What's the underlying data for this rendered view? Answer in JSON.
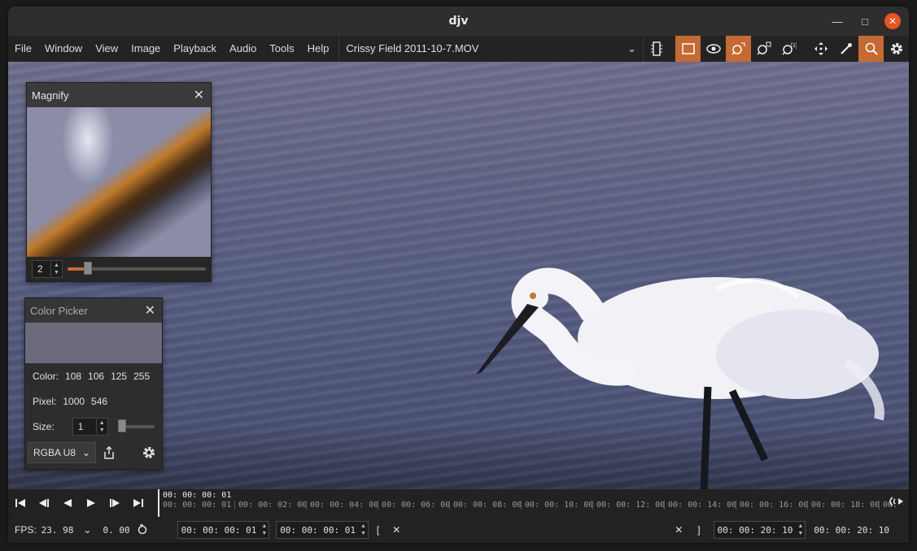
{
  "app": {
    "title": "djv"
  },
  "menu": [
    "File",
    "Window",
    "View",
    "Image",
    "Playback",
    "Audio",
    "Tools",
    "Help"
  ],
  "file": {
    "name": "Crissy Field 2011-10-7.MOV"
  },
  "magnify": {
    "title": "Magnify",
    "zoom": "2",
    "zoom_level": 0.15
  },
  "color_picker": {
    "title": "Color Picker",
    "swatch": "#6c6a7d",
    "color_label": "Color:",
    "color_values": [
      "108",
      "106",
      "125",
      "255"
    ],
    "pixel_label": "Pixel:",
    "pixel_values": [
      "1000",
      "546"
    ],
    "size_label": "Size:",
    "size": "1",
    "size_level": 0.0,
    "format": "RGBA U8"
  },
  "timeline": {
    "current": "00: 00: 00: 01",
    "ticks": [
      "00: 00: 00: 01",
      "00: 00: 02: 00",
      "00: 00: 04: 00",
      "00: 00: 06: 00",
      "00: 00: 08: 00",
      "00: 00: 10: 00",
      "00: 00: 12: 00",
      "00: 00: 14: 00",
      "00: 00: 16: 00",
      "00: 00: 18: 00",
      "00: 00"
    ]
  },
  "status": {
    "fps_label": "FPS:",
    "fps": "23. 98",
    "speed": "0. 00",
    "in_point": "00: 00: 00: 01",
    "current_frame": "00: 00: 00: 01",
    "in_bracket": "[",
    "out_bracket": "]",
    "out_point": "00: 00: 20: 10",
    "duration": "00: 00: 20: 10"
  },
  "colors": {
    "accent": "#c56a32",
    "close": "#e95420"
  }
}
